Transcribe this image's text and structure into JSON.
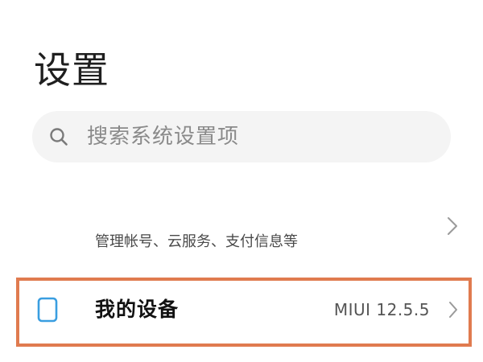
{
  "header": {
    "title": "设置"
  },
  "search": {
    "placeholder": "搜索系统设置项",
    "icon": "search-icon"
  },
  "account": {
    "subtitle": "管理帐号、云服务、支付信息等",
    "chevron_icon": "chevron-right-icon"
  },
  "device": {
    "label": "我的设备",
    "version": "MIUI 12.5.5",
    "icon": "phone-icon",
    "icon_color": "#3a9ee0",
    "chevron_icon": "chevron-right-icon",
    "highlight_color": "#e07b4f"
  }
}
